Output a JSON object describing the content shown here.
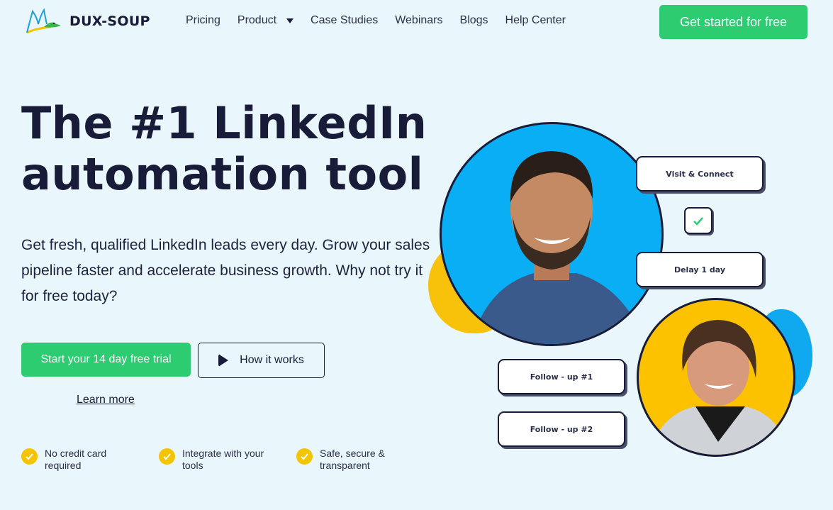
{
  "header": {
    "brand": "DUX-SOUP",
    "nav": [
      {
        "label": "Pricing",
        "dropdown": false
      },
      {
        "label": "Product",
        "dropdown": true
      },
      {
        "label": "Case Studies",
        "dropdown": false
      },
      {
        "label": "Webinars",
        "dropdown": false
      },
      {
        "label": "Blogs",
        "dropdown": false
      },
      {
        "label": "Help Center",
        "dropdown": false
      }
    ],
    "cta": "Get started for free"
  },
  "hero": {
    "headline_line1": "The #1 LinkedIn",
    "headline_line2": "automation tool",
    "subtitle": "Get fresh, qualified LinkedIn leads every day. Grow your sales pipeline faster and accelerate business growth. Why not try it for free today?",
    "trial_button": "Start your 14 day free trial",
    "how_button": "How it works",
    "learn_more": "Learn more",
    "features": [
      {
        "icon": "check-icon",
        "label": "No credit card required"
      },
      {
        "icon": "check-icon",
        "label": "Integrate with your tools"
      },
      {
        "icon": "check-icon",
        "label": "Safe, secure & transparent"
      }
    ]
  },
  "illustration": {
    "steps": {
      "visit_connect": "Visit & Connect",
      "delay": "Delay 1 day",
      "followup1": "Follow - up #1",
      "followup2": "Follow - up #2"
    }
  },
  "colors": {
    "background": "#e9f6fc",
    "primary_green": "#2ecc71",
    "navy": "#181c38",
    "accent_yellow": "#f5c400",
    "accent_blue": "#0aaef5"
  }
}
